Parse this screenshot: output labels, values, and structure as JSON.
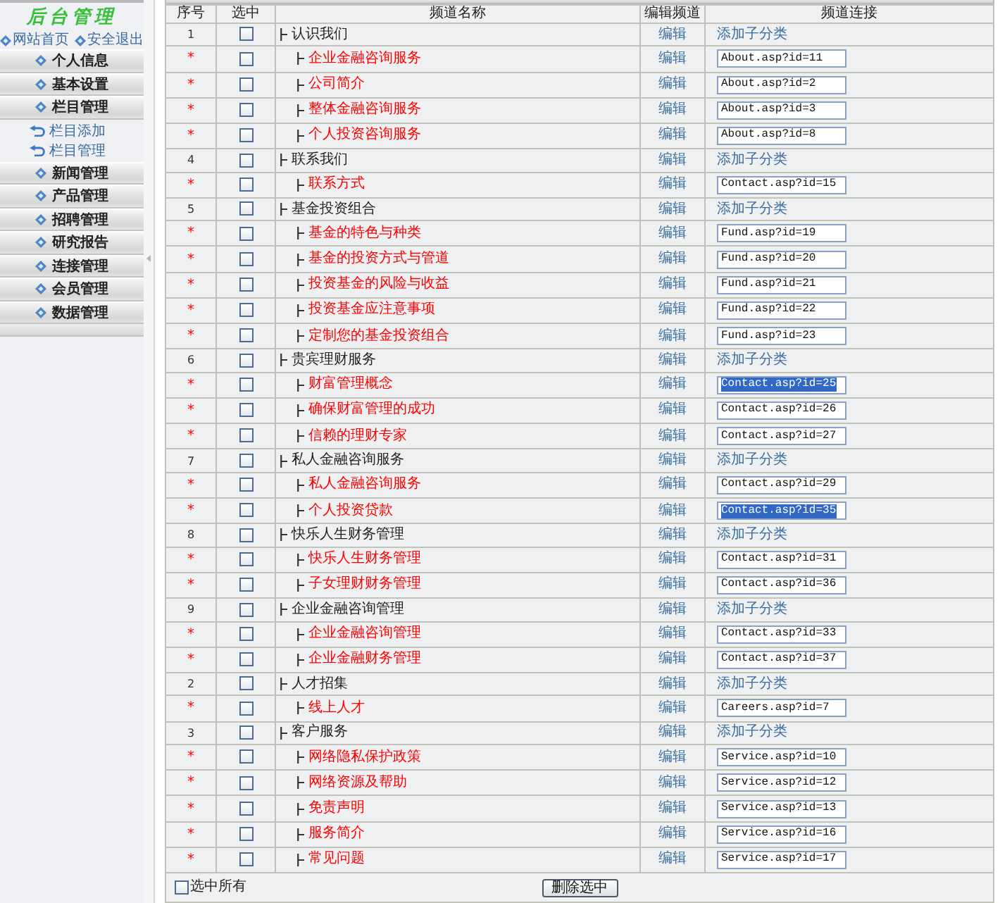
{
  "sidebar": {
    "title": "后台管理",
    "links": [
      "网站首页",
      "安全退出"
    ],
    "menu": [
      {
        "label": "个人信息"
      },
      {
        "label": "基本设置"
      },
      {
        "label": "栏目管理",
        "children": [
          {
            "label": "栏目添加"
          },
          {
            "label": "栏目管理"
          }
        ]
      },
      {
        "label": "新闻管理"
      },
      {
        "label": "产品管理"
      },
      {
        "label": "招聘管理"
      },
      {
        "label": "研究报告"
      },
      {
        "label": "连接管理"
      },
      {
        "label": "会员管理"
      },
      {
        "label": "数据管理"
      }
    ]
  },
  "table": {
    "columns": [
      "序号",
      "选中",
      "频道名称",
      "编辑频道",
      "频道连接"
    ],
    "rows": [
      {
        "no": "1",
        "checked": false,
        "name": "认识我们",
        "edit": "编辑",
        "add_link": "添加子分类",
        "children": [
          {
            "no": "*",
            "checked": false,
            "name": "企业金融咨询服务",
            "edit": "编辑",
            "url": "About.asp?id=11",
            "highlighted": false
          },
          {
            "no": "*",
            "checked": false,
            "name": "公司简介",
            "edit": "编辑",
            "url": "About.asp?id=2",
            "highlighted": false
          },
          {
            "no": "*",
            "checked": false,
            "name": "整体金融咨询服务",
            "edit": "编辑",
            "url": "About.asp?id=3",
            "highlighted": false
          },
          {
            "no": "*",
            "checked": false,
            "name": "个人投资咨询服务",
            "edit": "编辑",
            "url": "About.asp?id=8",
            "highlighted": false
          }
        ]
      },
      {
        "no": "4",
        "checked": false,
        "name": "联系我们",
        "edit": "编辑",
        "add_link": "添加子分类",
        "children": [
          {
            "no": "*",
            "checked": false,
            "name": "联系方式",
            "edit": "编辑",
            "url": "Contact.asp?id=15",
            "highlighted": false
          }
        ]
      },
      {
        "no": "5",
        "checked": false,
        "name": "基金投资组合",
        "edit": "编辑",
        "add_link": "添加子分类",
        "children": [
          {
            "no": "*",
            "checked": false,
            "name": "基金的特色与种类",
            "edit": "编辑",
            "url": "Fund.asp?id=19",
            "highlighted": false
          },
          {
            "no": "*",
            "checked": false,
            "name": "基金的投资方式与管道",
            "edit": "编辑",
            "url": "Fund.asp?id=20",
            "highlighted": false
          },
          {
            "no": "*",
            "checked": false,
            "name": "投资基金的风险与收益",
            "edit": "编辑",
            "url": "Fund.asp?id=21",
            "highlighted": false
          },
          {
            "no": "*",
            "checked": false,
            "name": "投资基金应注意事项",
            "edit": "编辑",
            "url": "Fund.asp?id=22",
            "highlighted": false
          },
          {
            "no": "*",
            "checked": false,
            "name": "定制您的基金投资组合",
            "edit": "编辑",
            "url": "Fund.asp?id=23",
            "highlighted": false
          }
        ]
      },
      {
        "no": "6",
        "checked": false,
        "name": "贵宾理财服务",
        "edit": "编辑",
        "add_link": "添加子分类",
        "children": [
          {
            "no": "*",
            "checked": false,
            "name": "财富管理概念",
            "edit": "编辑",
            "url": "Contact.asp?id=25",
            "highlighted": true
          },
          {
            "no": "*",
            "checked": false,
            "name": "确保财富管理的成功",
            "edit": "编辑",
            "url": "Contact.asp?id=26",
            "highlighted": false
          },
          {
            "no": "*",
            "checked": false,
            "name": "信赖的理财专家",
            "edit": "编辑",
            "url": "Contact.asp?id=27",
            "highlighted": false
          }
        ]
      },
      {
        "no": "7",
        "checked": false,
        "name": "私人金融咨询服务",
        "edit": "编辑",
        "add_link": "添加子分类",
        "children": [
          {
            "no": "*",
            "checked": false,
            "name": "私人金融咨询服务",
            "edit": "编辑",
            "url": "Contact.asp?id=29",
            "highlighted": false
          },
          {
            "no": "*",
            "checked": false,
            "name": "个人投资贷款",
            "edit": "编辑",
            "url": "Contact.asp?id=35",
            "highlighted": true
          }
        ]
      },
      {
        "no": "8",
        "checked": false,
        "name": "快乐人生财务管理",
        "edit": "编辑",
        "add_link": "添加子分类",
        "children": [
          {
            "no": "*",
            "checked": false,
            "name": "快乐人生财务管理",
            "edit": "编辑",
            "url": "Contact.asp?id=31",
            "highlighted": false
          },
          {
            "no": "*",
            "checked": false,
            "name": "子女理财财务管理",
            "edit": "编辑",
            "url": "Contact.asp?id=36",
            "highlighted": false
          }
        ]
      },
      {
        "no": "9",
        "checked": false,
        "name": "企业金融咨询管理",
        "edit": "编辑",
        "add_link": "添加子分类",
        "children": [
          {
            "no": "*",
            "checked": false,
            "name": "企业金融咨询管理",
            "edit": "编辑",
            "url": "Contact.asp?id=33",
            "highlighted": false
          },
          {
            "no": "*",
            "checked": false,
            "name": "企业金融财务管理",
            "edit": "编辑",
            "url": "Contact.asp?id=37",
            "highlighted": false
          }
        ]
      },
      {
        "no": "2",
        "checked": false,
        "name": "人才招集",
        "edit": "编辑",
        "add_link": "添加子分类",
        "children": [
          {
            "no": "*",
            "checked": false,
            "name": "线上人才",
            "edit": "编辑",
            "url": "Careers.asp?id=7",
            "highlighted": false
          }
        ]
      },
      {
        "no": "3",
        "checked": false,
        "name": "客户服务",
        "edit": "编辑",
        "add_link": "添加子分类",
        "children": [
          {
            "no": "*",
            "checked": false,
            "name": "网络隐私保护政策",
            "edit": "编辑",
            "url": "Service.asp?id=10",
            "highlighted": false
          },
          {
            "no": "*",
            "checked": false,
            "name": "网络资源及帮助",
            "edit": "编辑",
            "url": "Service.asp?id=12",
            "highlighted": false
          },
          {
            "no": "*",
            "checked": false,
            "name": "免责声明",
            "edit": "编辑",
            "url": "Service.asp?id=13",
            "highlighted": false
          },
          {
            "no": "*",
            "checked": false,
            "name": "服务简介",
            "edit": "编辑",
            "url": "Service.asp?id=16",
            "highlighted": false
          },
          {
            "no": "*",
            "checked": false,
            "name": "常见问题",
            "edit": "编辑",
            "url": "Service.asp?id=17",
            "highlighted": false
          }
        ]
      }
    ]
  },
  "footer": {
    "select_all": {
      "label": "选中所有",
      "checked": false
    },
    "button": "删除选中"
  }
}
